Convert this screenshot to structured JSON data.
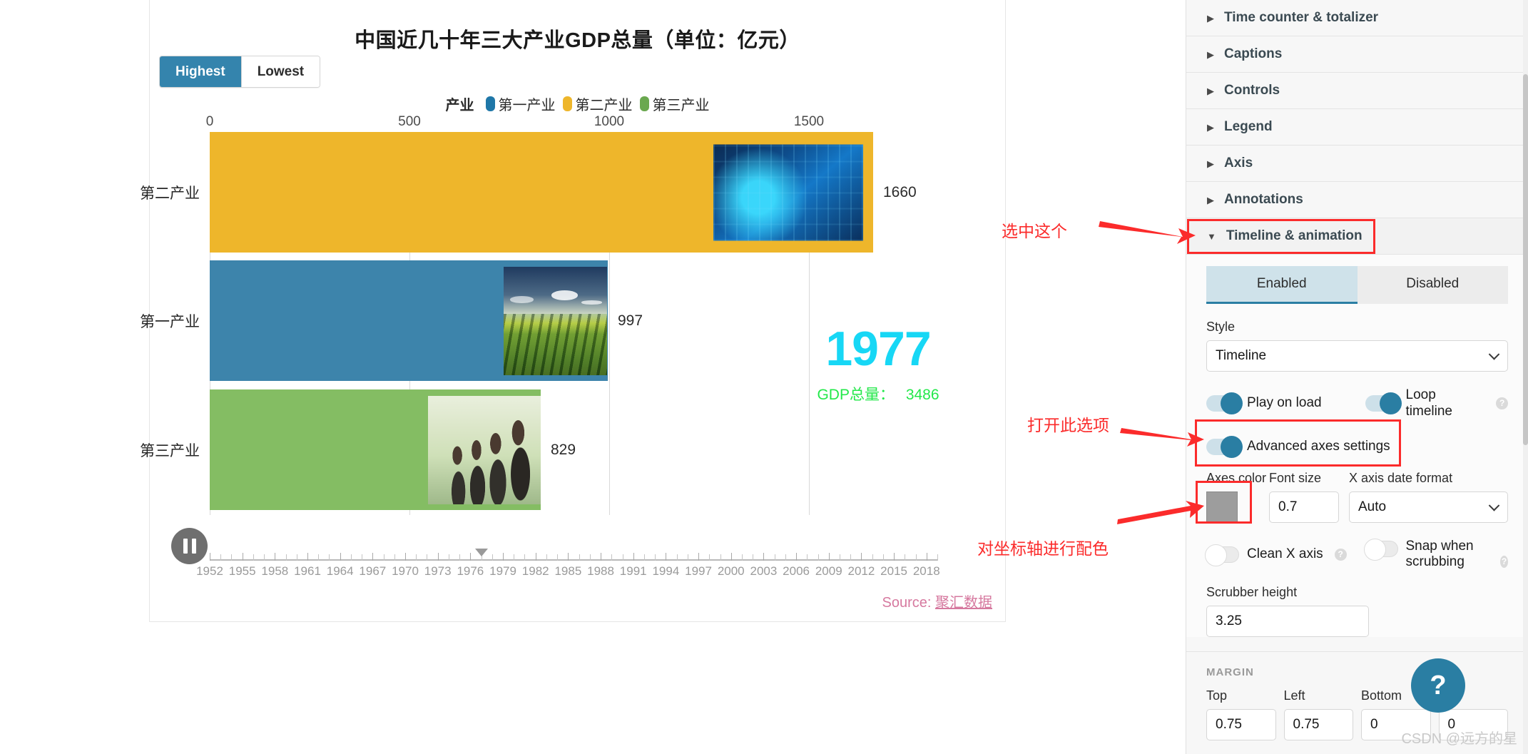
{
  "chart_data": {
    "type": "bar",
    "orientation": "horizontal",
    "title": "中国近几十年三大产业GDP总量（单位：亿元）",
    "xlabel": "",
    "ylabel": "",
    "xlim": [
      0,
      1800
    ],
    "xticks": [
      0,
      500,
      1000,
      1500
    ],
    "grid": true,
    "legend_position": "top-center",
    "legend_title": "产业",
    "categories": [
      "第二产业",
      "第一产业",
      "第三产业"
    ],
    "values": [
      1660,
      997,
      829
    ],
    "colors": [
      "#eeb62b",
      "#3d84ab",
      "#84bd63"
    ],
    "series": [
      {
        "name": "第二产业",
        "value": 1660,
        "color": "#eeb62b"
      },
      {
        "name": "第一产业",
        "value": 997,
        "color": "#3d84ab"
      },
      {
        "name": "第三产业",
        "value": 829,
        "color": "#84bd63"
      }
    ],
    "current_year": "1977",
    "total_label": "GDP总量：",
    "total_value": "3486",
    "timeline_years": [
      "1952",
      "1955",
      "1958",
      "1961",
      "1964",
      "1967",
      "1970",
      "1973",
      "1976",
      "1979",
      "1982",
      "1985",
      "1988",
      "1991",
      "1994",
      "1997",
      "2000",
      "2003",
      "2006",
      "2009",
      "2012",
      "2015",
      "2018"
    ],
    "timeline_min": 1952,
    "timeline_max": 2019,
    "timeline_position_year": 1977,
    "source_prefix": "Source: ",
    "source_link": "聚汇数据"
  },
  "chart_controls": {
    "highest_label": "Highest",
    "lowest_label": "Lowest",
    "active": "Highest",
    "play_icon": "pause-icon"
  },
  "panel": {
    "accordion": [
      {
        "label": "Time counter & totalizer",
        "open": false,
        "icon": "chevron-right-icon"
      },
      {
        "label": "Captions",
        "open": false,
        "icon": "chevron-right-icon"
      },
      {
        "label": "Controls",
        "open": false,
        "icon": "chevron-right-icon"
      },
      {
        "label": "Legend",
        "open": false,
        "icon": "chevron-right-icon"
      },
      {
        "label": "Axis",
        "open": false,
        "icon": "chevron-right-icon"
      },
      {
        "label": "Annotations",
        "open": false,
        "icon": "chevron-right-icon"
      },
      {
        "label": "Timeline & animation",
        "open": true,
        "icon": "chevron-down-icon"
      }
    ],
    "timeline_section": {
      "enabled_label": "Enabled",
      "disabled_label": "Disabled",
      "active_state": "Enabled",
      "style_label": "Style",
      "style_value": "Timeline",
      "play_on_load_label": "Play on load",
      "play_on_load_state": "on",
      "loop_timeline_label": "Loop timeline",
      "loop_timeline_state": "on",
      "advanced_axes_label": "Advanced axes settings",
      "advanced_axes_state": "on",
      "axes_color_label": "Axes color",
      "axes_color_value": "#9d9d9d",
      "font_size_label": "Font size",
      "font_size_value": "0.7",
      "x_axis_date_format_label": "X axis date format",
      "x_axis_date_format_value": "Auto",
      "clean_x_axis_label": "Clean X axis",
      "clean_x_axis_state": "off",
      "snap_when_scrubbing_label": "Snap when scrubbing",
      "snap_when_scrubbing_state": "off",
      "scrubber_height_label": "Scrubber height",
      "scrubber_height_value": "3.25"
    },
    "margin": {
      "section_title": "MARGIN",
      "top_label": "Top",
      "top_value": "0.75",
      "left_label": "Left",
      "left_value": "0.75",
      "bottom_label": "Bottom",
      "bottom_value": "0",
      "right_value": "0"
    },
    "help_button_label": "?"
  },
  "annotations": {
    "note1": "选中这个",
    "note2": "打开此选项",
    "note3": "对坐标轴进行配色",
    "accent_color": "#fb2b2b"
  },
  "watermark": "CSDN @远方的星"
}
